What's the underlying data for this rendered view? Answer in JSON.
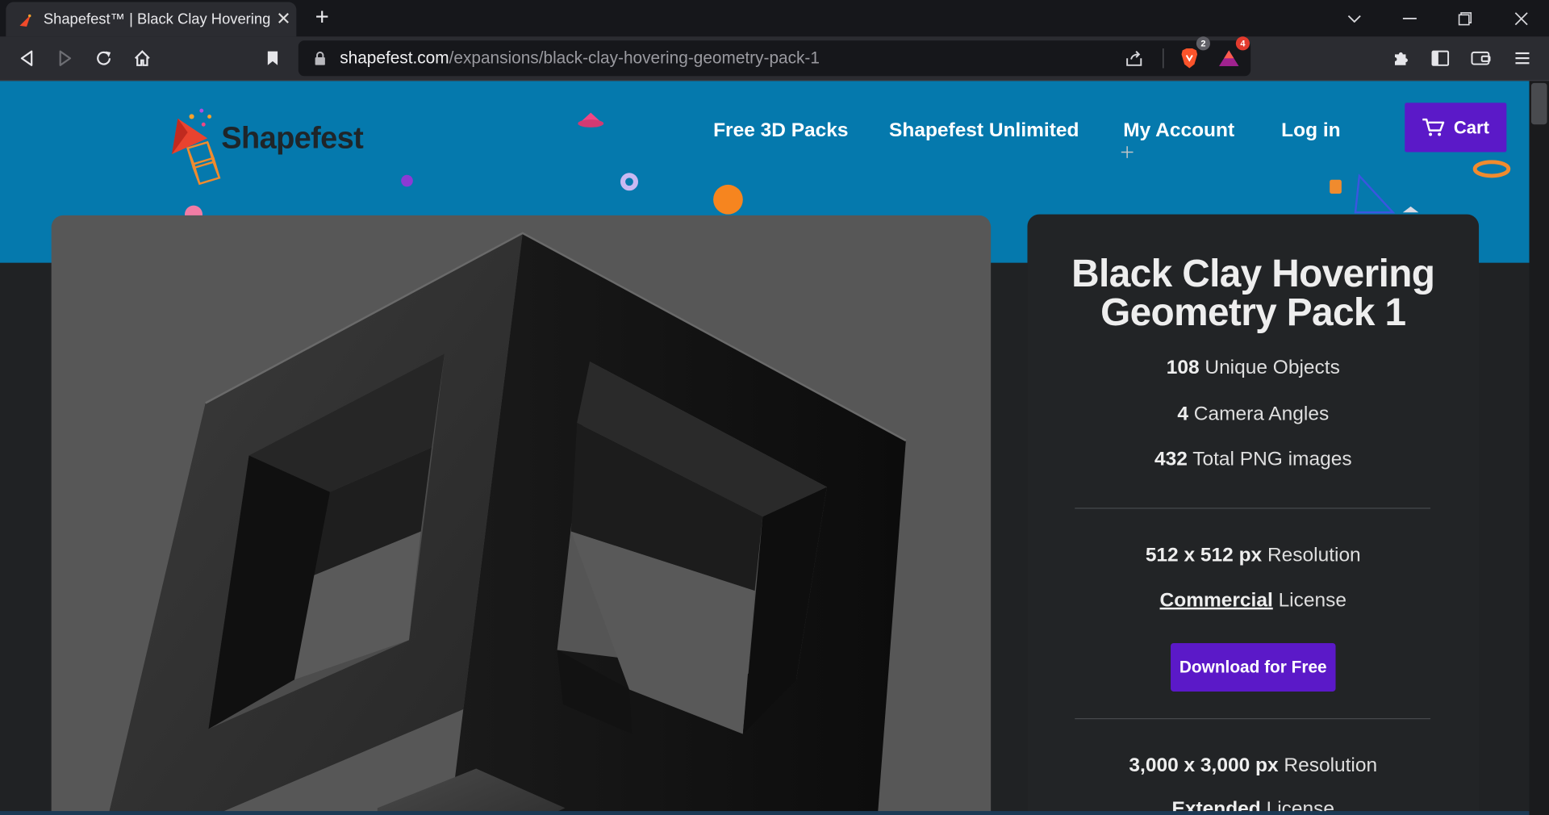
{
  "browser": {
    "tab_title": "Shapefest™ | Black Clay Hovering",
    "url_host": "shapefest.com",
    "url_path": "/expansions/black-clay-hovering-geometry-pack-1",
    "brave_shield_count": "2",
    "rewards_count": "4",
    "icons": [
      "back-icon",
      "forward-icon",
      "reload-icon",
      "home-icon",
      "bookmark-icon",
      "lock-icon",
      "share-icon",
      "brave-shield-icon",
      "brave-rewards-icon",
      "extensions-icon",
      "sidebar-icon",
      "wallet-icon",
      "menu-icon",
      "tab-search-icon",
      "minimize-icon",
      "restore-icon",
      "close-icon"
    ]
  },
  "site": {
    "brand": "Shapefest",
    "nav": [
      "Free 3D Packs",
      "Shapefest Unlimited",
      "My Account",
      "Log in"
    ],
    "cart_label": "Cart",
    "colors": {
      "header": "#0579ad",
      "accent": "#5b19c8",
      "panel": "#222426"
    }
  },
  "product": {
    "title_line1": "Black Clay Hovering",
    "title_line2": "Geometry Pack 1",
    "unique_objects_value": "108",
    "unique_objects_label": "Unique Objects",
    "camera_angles_value": "4",
    "camera_angles_label": "Camera Angles",
    "total_png_value": "432",
    "total_png_label": "Total PNG images",
    "free_res_value": "512 x 512 px",
    "free_res_label": "Resolution",
    "free_license_value": "Commercial",
    "free_license_label": "License",
    "download_label": "Download for Free",
    "paid_res_value": "3,000 x 3,000 px",
    "paid_res_label": "Resolution",
    "paid_license_value": "Extended",
    "paid_license_label": "License"
  }
}
